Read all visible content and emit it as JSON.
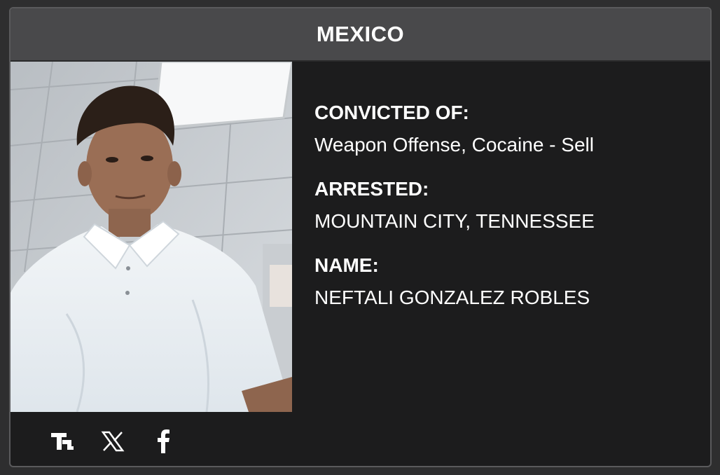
{
  "header": {
    "title": "MEXICO"
  },
  "photo": {
    "subject": "mugshot-photo"
  },
  "fields": [
    {
      "label": "CONVICTED OF:",
      "value": "Weapon Offense, Cocaine - Sell"
    },
    {
      "label": "ARRESTED:",
      "value": "MOUNTAIN CITY, TENNESSEE"
    },
    {
      "label": "NAME:",
      "value": "NEFTALI GONZALEZ ROBLES"
    }
  ],
  "social": {
    "icons": [
      "truth-social-icon",
      "x-icon",
      "facebook-icon"
    ]
  },
  "colors": {
    "page_background": "#2e2e2f",
    "card_background": "#1c1c1d",
    "header_background": "#49494b",
    "text": "#ffffff"
  }
}
